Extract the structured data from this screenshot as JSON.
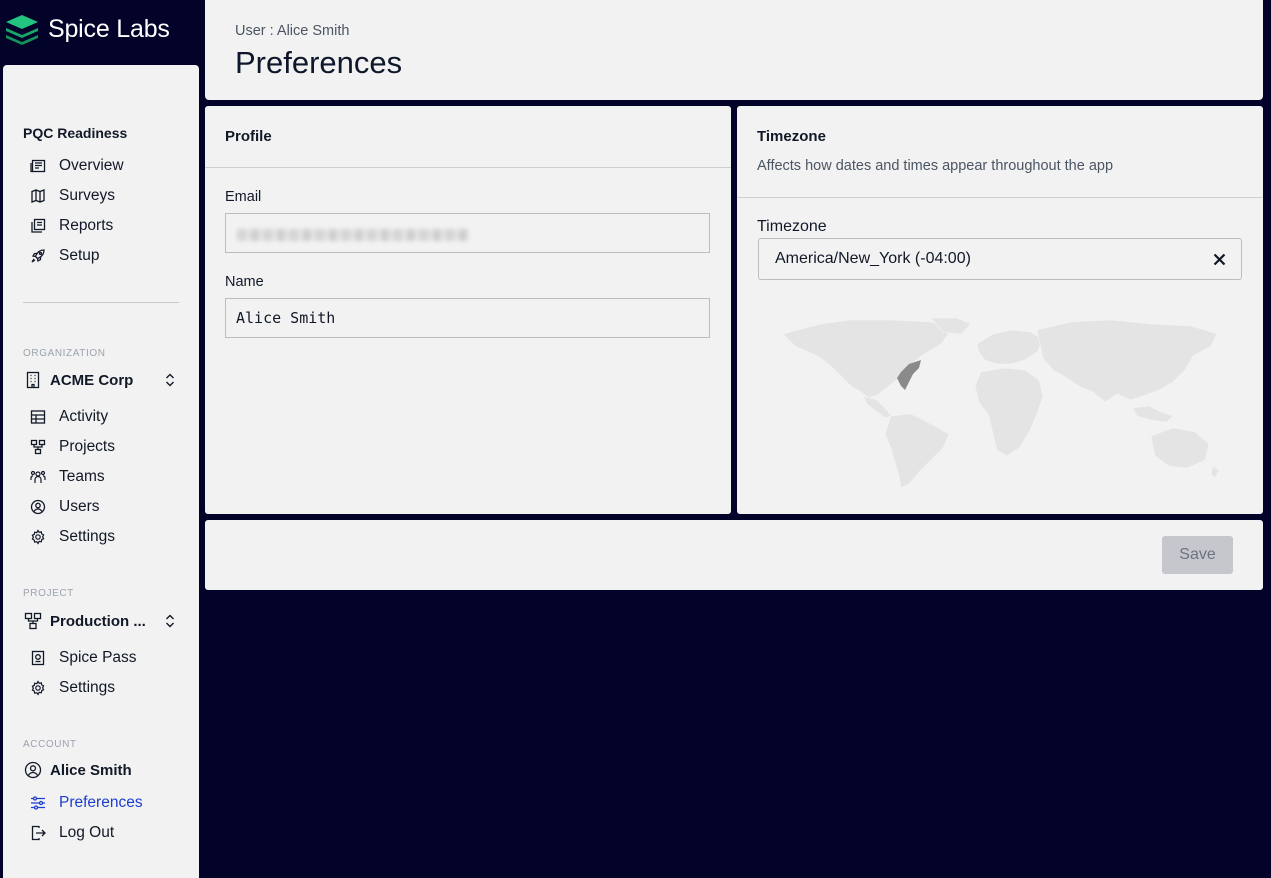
{
  "brand": {
    "name": "Spice Labs",
    "accent": "#1fbf7a"
  },
  "sidebar": {
    "pqc": {
      "title": "PQC Readiness",
      "items": [
        {
          "label": "Overview",
          "icon": "newspaper-icon"
        },
        {
          "label": "Surveys",
          "icon": "map-icon"
        },
        {
          "label": "Reports",
          "icon": "documents-icon"
        },
        {
          "label": "Setup",
          "icon": "rocket-icon"
        }
      ]
    },
    "organization": {
      "caption": "ORGANIZATION",
      "switcher_label": "ACME Corp",
      "items": [
        {
          "label": "Activity",
          "icon": "table-icon"
        },
        {
          "label": "Projects",
          "icon": "hierarchy-icon"
        },
        {
          "label": "Teams",
          "icon": "team-icon"
        },
        {
          "label": "Users",
          "icon": "user-circle-icon"
        },
        {
          "label": "Settings",
          "icon": "gear-icon"
        }
      ]
    },
    "project": {
      "caption": "PROJECT",
      "switcher_label": "Production ...",
      "items": [
        {
          "label": "Spice Pass",
          "icon": "passport-icon"
        },
        {
          "label": "Settings",
          "icon": "gear-icon"
        }
      ]
    },
    "account": {
      "caption": "ACCOUNT",
      "user_name": "Alice Smith",
      "items": [
        {
          "label": "Preferences",
          "icon": "sliders-icon",
          "active": true
        },
        {
          "label": "Log Out",
          "icon": "logout-icon"
        }
      ]
    }
  },
  "header": {
    "breadcrumb": "User : Alice Smith",
    "title": "Preferences"
  },
  "profile": {
    "title": "Profile",
    "email_label": "Email",
    "email_value": "",
    "name_label": "Name",
    "name_value": "Alice Smith"
  },
  "timezone": {
    "title": "Timezone",
    "subtitle": "Affects how dates and times appear throughout the app",
    "field_label": "Timezone",
    "value": "America/New_York (-04:00)"
  },
  "footer": {
    "save_label": "Save"
  },
  "colors": {
    "background": "#03032a",
    "panel": "#f2f2f2",
    "active_nav": "#1d3ecf",
    "disabled_button": "#c5c7cc"
  }
}
